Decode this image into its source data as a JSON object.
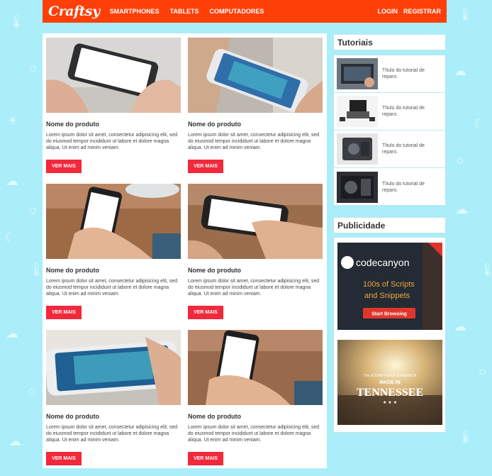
{
  "header": {
    "logo": "Craftsy",
    "nav": [
      "SMARTPHONES",
      "TABLETS",
      "COMPUTADORES"
    ],
    "login": "LOGIN",
    "register": "REGISTRAR",
    "accent": "#fe3f08"
  },
  "products": [
    {
      "name": "Nome do produto",
      "desc": "Lorem ipsum dolor sit amet, consectetur adipisicing elit, sed do eiusmod tempor incididunt ut labore et dolore magna aliqua. Ut enim ad minim veniam.",
      "button": "VER MAIS"
    },
    {
      "name": "Nome do produto",
      "desc": "Lorem ipsum dolor sit amet, consectetur adipisicing elit, sed do eiusmod tempor incididunt ut labore et dolore magna aliqua. Ut enim ad minim veniam.",
      "button": "VER MAIS"
    },
    {
      "name": "Nome do produto",
      "desc": "Lorem ipsum dolor sit amet, consectetur adipisicing elit, sed do eiusmod tempor incididunt ut labore et dolore magna aliqua. Ut enim ad minim veniam.",
      "button": "VER MAIS"
    },
    {
      "name": "Nome do produto",
      "desc": "Lorem ipsum dolor sit amet, consectetur adipisicing elit, sed do eiusmod tempor incididunt ut labore et dolore magna aliqua. Ut enim ad minim veniam.",
      "button": "VER MAIS"
    },
    {
      "name": "Nome do produto",
      "desc": "Lorem ipsum dolor sit amet, consectetur adipisicing elit, sed do eiusmod tempor incididunt ut labore et dolore magna aliqua. Ut enim ad minim veniam.",
      "button": "VER MAIS"
    },
    {
      "name": "Nome do produto",
      "desc": "Lorem ipsum dolor sit amet, consectetur adipisicing elit, sed do eiusmod tempor incididunt ut labore et dolore magna aliqua. Ut enim ad minim veniam.",
      "button": "VER MAIS"
    }
  ],
  "sidebar": {
    "tutorials_title": "Tutoriais",
    "tutorials": [
      {
        "title": "Título do tutorial de reparo."
      },
      {
        "title": "Título do tutorial de reparo."
      },
      {
        "title": "Título do tutorial de reparo."
      },
      {
        "title": "Título do tutorial de reparo."
      }
    ],
    "ads_title": "Publicidade",
    "ad1": {
      "brand": "codecanyon",
      "headline1": "100s of Scripts",
      "headline2": "and Snippets",
      "cta": "Start Browsing"
    },
    "ad2": {
      "line1": "The SOUNDTRACK of AMERICA",
      "line2": "MADE IN",
      "line3": "TENNESSEE"
    }
  }
}
